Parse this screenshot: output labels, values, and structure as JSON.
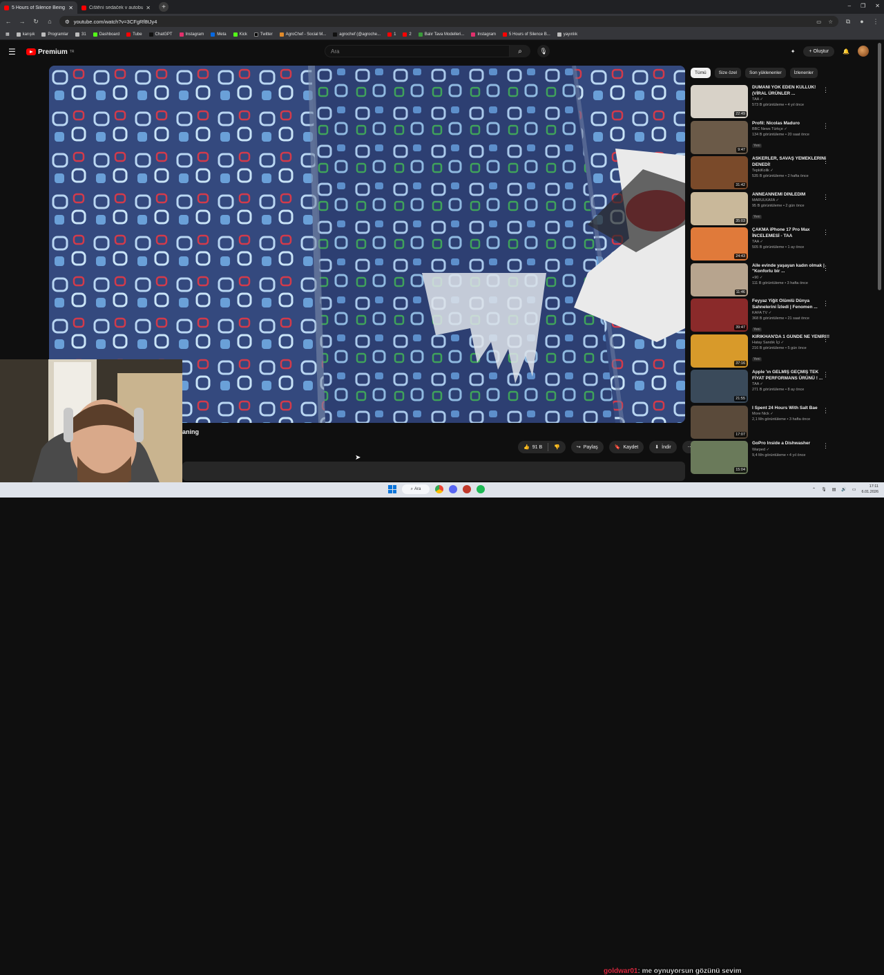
{
  "browser": {
    "tabs": [
      {
        "title": "5 Hours of Silence Being Randi...",
        "active": true
      },
      {
        "title": "Čištění sedaček v autobusu...",
        "active": false
      }
    ],
    "url": "youtube.com/watch?v=3CFgRf8tJy4",
    "bookmarks": [
      "karışık",
      "Programlar",
      "31",
      "Dashboard",
      "Tube",
      "ChatGPT",
      "Instagram",
      "Meta",
      "Kick",
      "Twitter",
      "AgroChef - Social M...",
      "agrochef (@agroche...",
      "1",
      "2",
      "Balır Tava Modelleri...",
      "Instagram",
      "5 Hours of Silence B...",
      "yayınlık"
    ]
  },
  "youtube": {
    "logo": "Premium",
    "logo_sup": "TR",
    "search_placeholder": "Ara",
    "create_label": "Oluştur",
    "video_title_fragment": "aning",
    "actions": {
      "like": "91 B",
      "share": "Paylaş",
      "save": "Kaydet",
      "download": "İndir"
    },
    "chips": [
      "Tümü",
      "Size özel",
      "Son yüklenenler",
      "İzlenenler"
    ],
    "recommendations": [
      {
        "title": "DUMANI YOK EDEN KÜLLÜK! (VİRAL ÜRÜNLER ...",
        "channel": "TAA",
        "stats": "573 B görüntüleme • 4 yıl önce",
        "duration": "22:49",
        "badge": "",
        "thumb": "#d8d2c8"
      },
      {
        "title": "Profil: Nicolas Maduro",
        "channel": "BBC News Türkçe",
        "stats": "134 B görüntüleme • 20 saat önce",
        "duration": "9:47",
        "badge": "Yeni",
        "thumb": "#6b5a48"
      },
      {
        "title": "ASKERLER, SAVAŞ YEMEKLERİNİ DENEDİ!",
        "channel": "TepkiKolik",
        "stats": "535 B görüntüleme • 2 hafta önce",
        "duration": "31:42",
        "badge": "",
        "thumb": "#7a4a2a"
      },
      {
        "title": "ANNEANNEMİ DİNLEDİM",
        "channel": "MARULKAFA",
        "stats": "95 B görüntüleme • 2 gün önce",
        "duration": "35:03",
        "badge": "Yeni",
        "thumb": "#c9b89a"
      },
      {
        "title": "ÇAKMA iPhone 17 Pro Max İNCELEMESİ - TAA",
        "channel": "TAA",
        "stats": "505 B görüntüleme • 1 ay önce",
        "duration": "24:43",
        "badge": "",
        "thumb": "#e07a3a"
      },
      {
        "title": "Aile evinde yaşayan kadın olmak | \"Konforlu bir ...",
        "channel": "+90",
        "stats": "111 B görüntüleme • 3 hafta önce",
        "duration": "11:46",
        "badge": "",
        "thumb": "#b7a48e"
      },
      {
        "title": "Feyyaz Yiğit Ölümlü Dünya Sahnelerini İzledi | Fenomen ...",
        "channel": "KAFA TV",
        "stats": "368 B görüntüleme • 21 saat önce",
        "duration": "39:47",
        "badge": "Yeni",
        "thumb": "#8a2a2a"
      },
      {
        "title": "KIRIKHAN'DA 1 GÜNDE NE YENİR!!!",
        "channel": "Hatay Sandık İçi",
        "stats": "216 B görüntüleme • 5 gün önce",
        "duration": "37:16",
        "badge": "Yeni",
        "thumb": "#d89a2a"
      },
      {
        "title": "Apple 'ın GELMİŞ GEÇMİŞ TEK FİYAT PERFORMANS ÜRÜNÜ ! ...",
        "channel": "TAA",
        "stats": "271 B görüntüleme • 8 ay önce",
        "duration": "21:55",
        "badge": "",
        "thumb": "#3a4a5a"
      },
      {
        "title": "I Spent 24 Hours With Salt Bae",
        "channel": "More Nick",
        "stats": "2,1 Mn görüntüleme • 3 hafta önce",
        "duration": "17:07",
        "badge": "",
        "thumb": "#5a4a3a"
      },
      {
        "title": "GoPro Inside a Dishwasher",
        "channel": "Warped",
        "stats": "9,4 Mn görüntüleme • 4 yıl önce",
        "duration": "15:04",
        "badge": "",
        "thumb": "#6a7a5a"
      }
    ]
  },
  "taskbar": {
    "search": "Ara",
    "chat_user": "goldwar01",
    "chat_message": ": me oynuyorsun gözünü sevim",
    "time": "17:11",
    "date": "6.01.2026"
  }
}
